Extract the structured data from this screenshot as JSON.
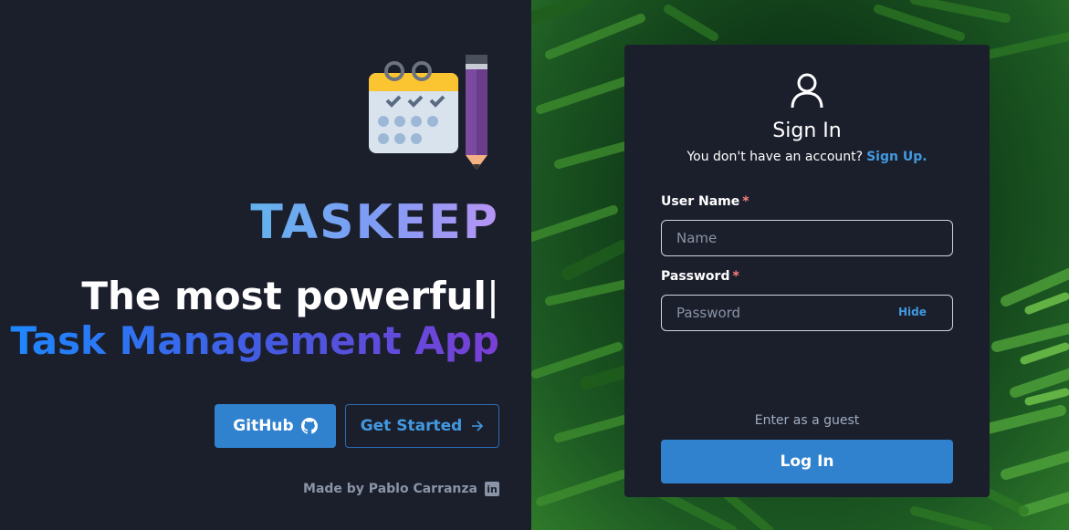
{
  "hero": {
    "brand": "TASKEEP",
    "tagline_line1": "The most powerful",
    "tagline_caret": "|",
    "tagline_line2": "Task Management App",
    "github_label": "GitHub",
    "get_started_label": "Get Started",
    "made_by": "Made by Pablo Carranza",
    "linkedin_glyph": "in"
  },
  "login": {
    "title": "Sign In",
    "no_account_text": "You don't have an account?",
    "sign_up_link": "Sign Up.",
    "username_label": "User Name",
    "username_placeholder": "Name",
    "password_label": "Password",
    "password_placeholder": "Password",
    "required_mark": "*",
    "hide_label": "Hide",
    "guest_link": "Enter as a guest",
    "login_button": "Log In"
  },
  "icons": {
    "logo": "calendar-pencil-icon",
    "github": "github-icon",
    "arrow": "arrow-right-icon",
    "linkedin": "linkedin-icon",
    "user": "user-icon"
  },
  "colors": {
    "panel_bg": "#1b1f2c",
    "accent": "#3182ce",
    "link": "#4299e1",
    "required": "#fc8181"
  }
}
